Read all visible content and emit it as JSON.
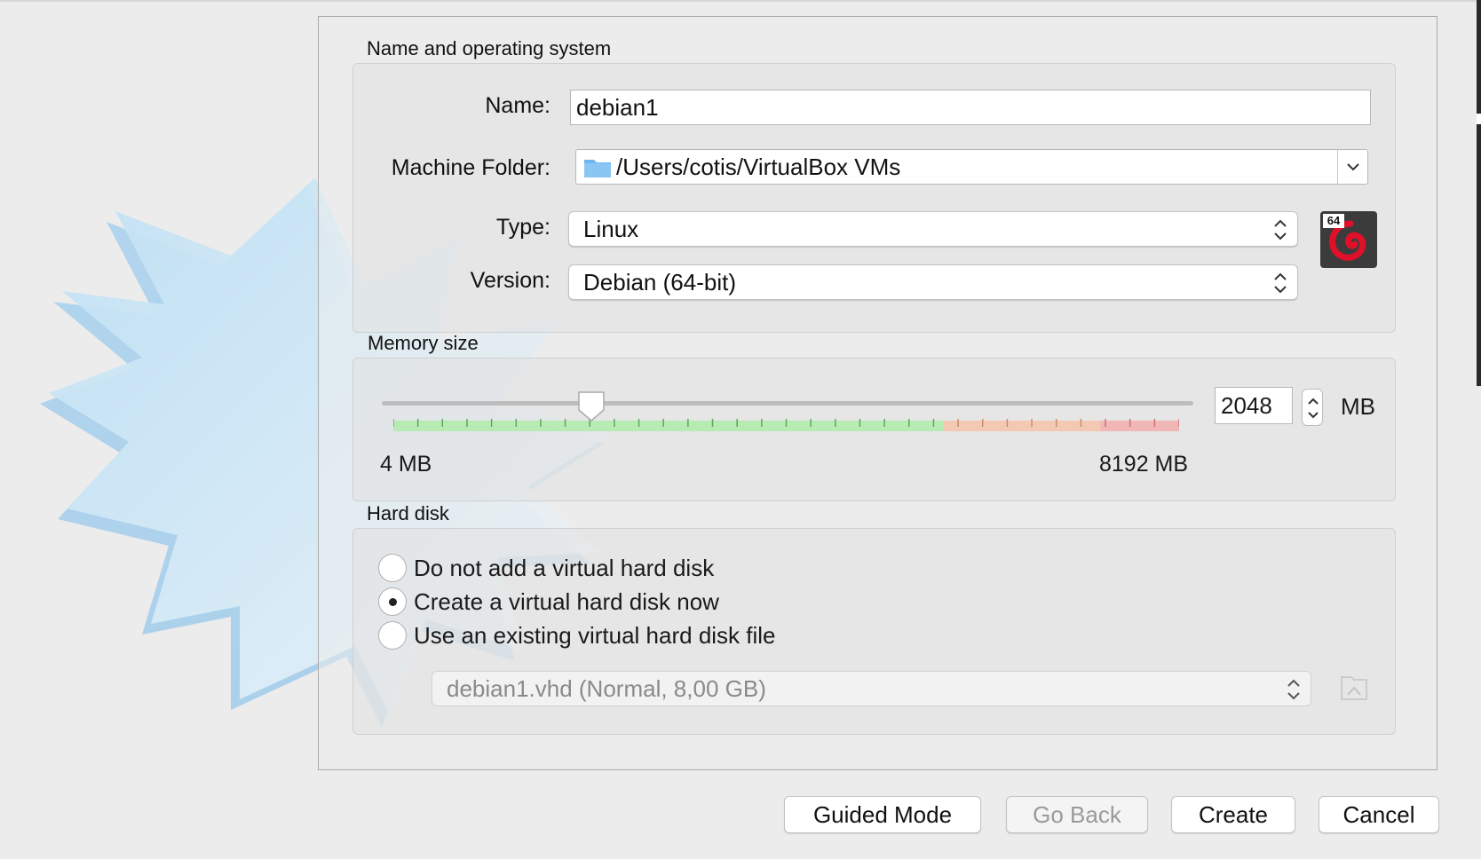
{
  "window": {
    "sections": {
      "name_os": "Name and operating system",
      "memory": "Memory size",
      "hard_disk": "Hard disk"
    }
  },
  "name_os": {
    "name_label": "Name:",
    "name_value": "debian1",
    "folder_label": "Machine Folder:",
    "folder_value": "/Users/cotis/VirtualBox VMs",
    "type_label": "Type:",
    "type_value": "Linux",
    "version_label": "Version:",
    "version_value": "Debian (64-bit)",
    "os_icon": "debian-logo-icon",
    "os_badge": "64"
  },
  "memory": {
    "value": "2048",
    "unit": "MB",
    "min_label": "4 MB",
    "max_label": "8192 MB",
    "min_mb": 4,
    "max_mb": 8192,
    "current_mb": 2048
  },
  "hard_disk": {
    "options": [
      {
        "label": "Do not add a virtual hard disk",
        "selected": false
      },
      {
        "label": "Create a virtual hard disk now",
        "selected": true
      },
      {
        "label": "Use an existing virtual hard disk file",
        "selected": false
      }
    ],
    "existing_file": "debian1.vhd (Normal, 8,00 GB)"
  },
  "buttons": {
    "guided": "Guided Mode",
    "back": "Go Back",
    "create": "Create",
    "cancel": "Cancel"
  },
  "colors": {
    "slider_green": "#b8ebb4",
    "slider_orange": "#f4c9b3",
    "slider_red": "#f1b6b6",
    "folder_blue": "#6fb6f0"
  }
}
